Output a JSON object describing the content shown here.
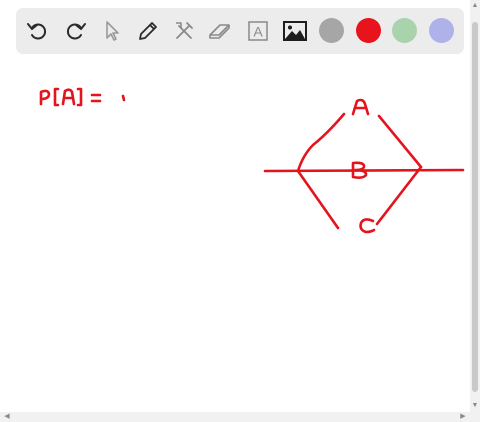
{
  "toolbar": {
    "tools": [
      {
        "name": "undo-icon"
      },
      {
        "name": "redo-icon"
      },
      {
        "name": "select-pointer-icon"
      },
      {
        "name": "pen-icon"
      },
      {
        "name": "tools-icon"
      },
      {
        "name": "eraser-icon"
      },
      {
        "name": "text-box-icon",
        "glyph": "A"
      },
      {
        "name": "image-icon"
      }
    ],
    "colors": [
      {
        "name": "gray",
        "hex": "#a6a6a6"
      },
      {
        "name": "red",
        "hex": "#e8131c"
      },
      {
        "name": "light-green",
        "hex": "#a9d3ad"
      },
      {
        "name": "lavender",
        "hex": "#afb1ea"
      }
    ]
  },
  "canvas": {
    "ink_color": "#e3141d",
    "handwriting": {
      "expression": "P[A] = '",
      "node_a": "A",
      "node_b": "B",
      "node_c": "C"
    }
  }
}
